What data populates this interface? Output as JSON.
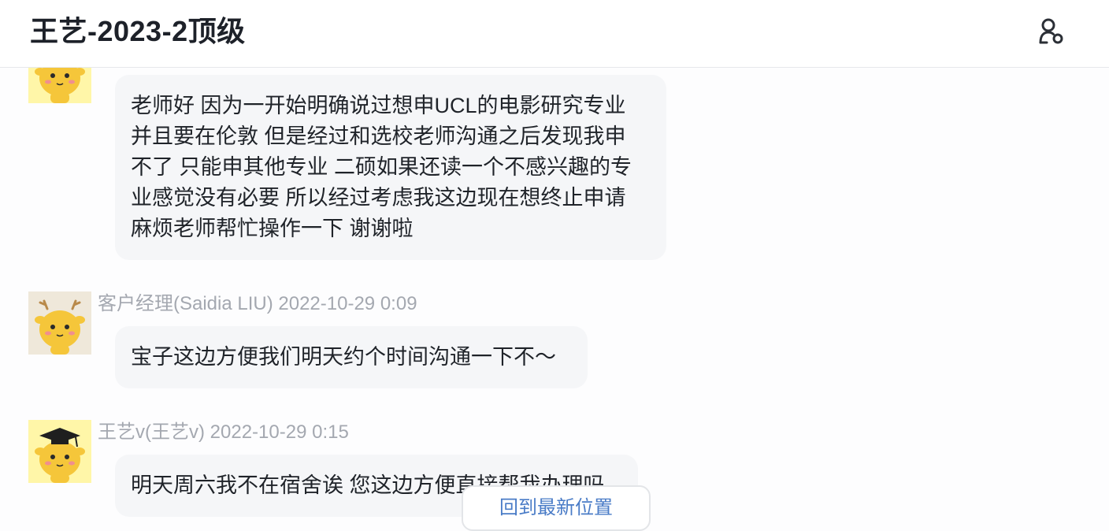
{
  "header": {
    "title": "王艺-2023-2顶级",
    "members_icon": "group-members-icon"
  },
  "messages": [
    {
      "avatar_icon": "deer-avatar-icon",
      "sender": "",
      "time": "",
      "lines": [
        "老师好 因为一开始明确说过想申UCL的电影研究专业",
        "并且要在伦敦 但是经过和选校老师沟通之后发现我申",
        "不了 只能申其他专业 二硕如果还读一个不感兴趣的专",
        "业感觉没有必要 所以经过考虑我这边现在想终止申请",
        "麻烦老师帮忙操作一下 谢谢啦"
      ]
    },
    {
      "avatar_icon": "deer-antlers-avatar-icon",
      "sender": "客户经理(Saidia LIU)",
      "time": "2022-10-29 0:09",
      "lines": [
        "宝子这边方便我们明天约个时间沟通一下不～"
      ]
    },
    {
      "avatar_icon": "deer-graduation-cap-avatar-icon",
      "sender": "王艺v(王艺v)",
      "time": "2022-10-29 0:15",
      "lines": [
        "明天周六我不在宿舍诶 您这边方便直接帮我办理吗"
      ]
    }
  ],
  "jump_to_latest": "回到最新位置",
  "colors": {
    "accent": "#4a7cc7",
    "bubble": "#f5f6f8",
    "meta_text": "#a4a8b0",
    "avatar_bg_yellow": "#fff6a8",
    "avatar_bg_beige": "#efe8da"
  }
}
